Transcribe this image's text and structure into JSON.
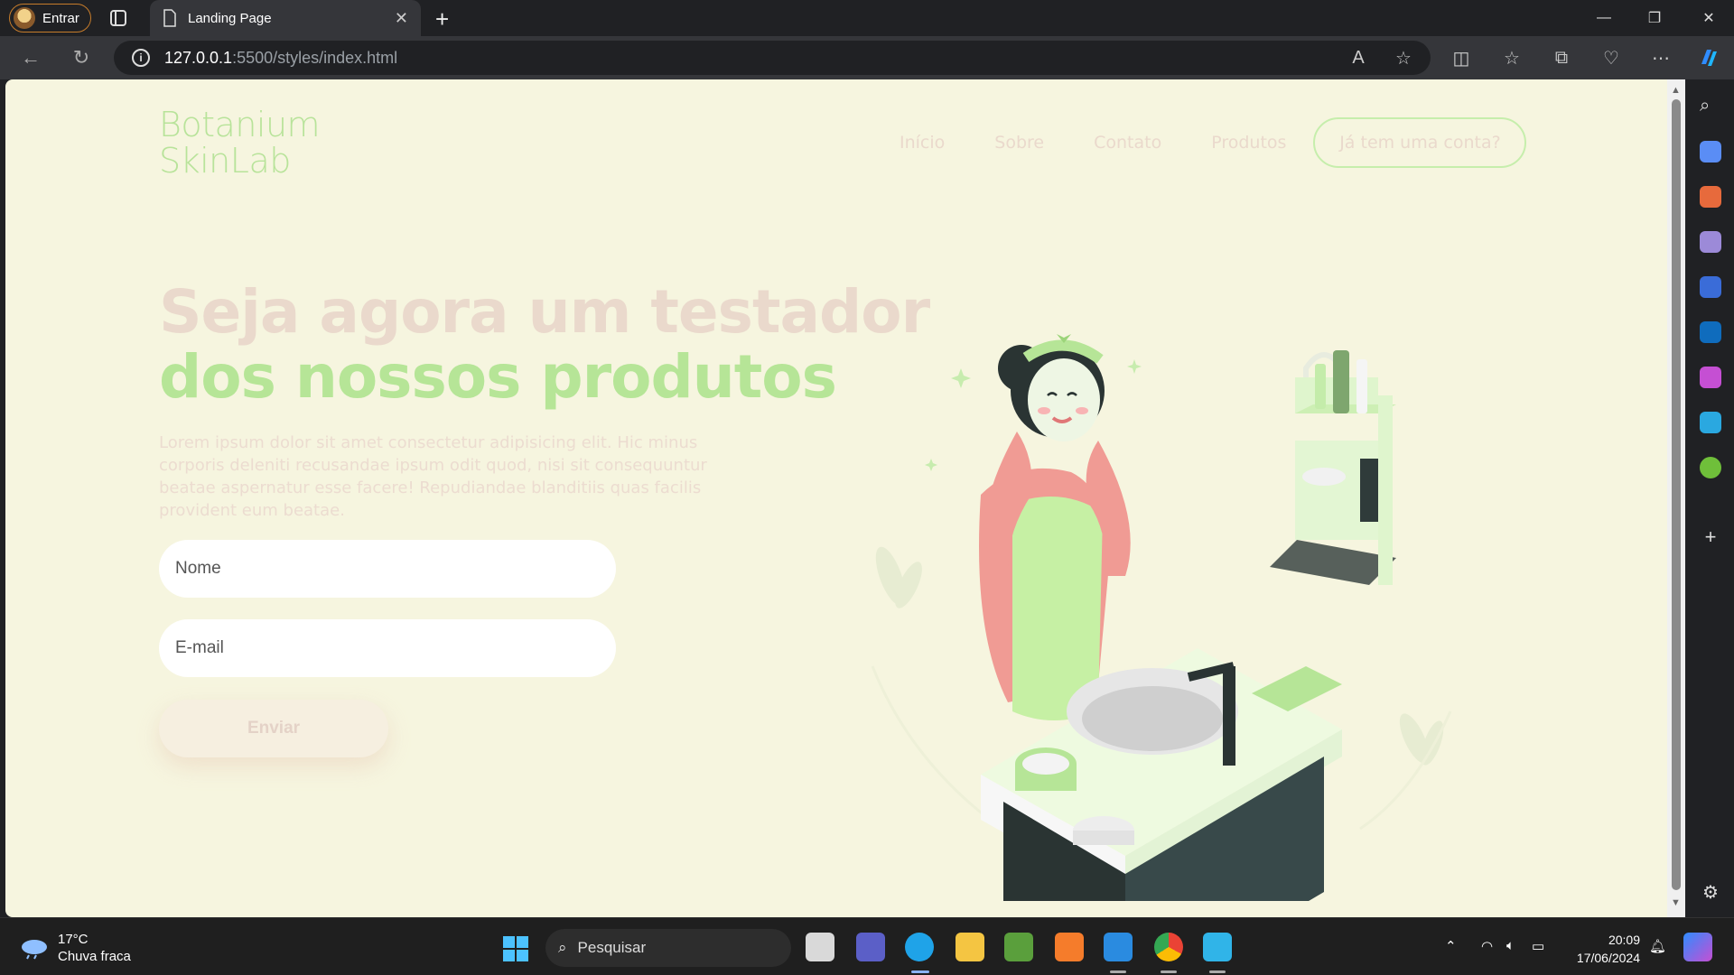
{
  "browser": {
    "profile_label": "Entrar",
    "tab_title": "Landing Page",
    "url_host": "127.0.0.1",
    "url_path": ":5500/styles/index.html"
  },
  "page": {
    "logo_line1": "Botanium",
    "logo_line2": "SkinLab",
    "nav": [
      "Início",
      "Sobre",
      "Contato",
      "Produtos"
    ],
    "cta": "Já tem uma conta?",
    "headline_line1": "Seja agora um testador",
    "headline_line2": "dos nossos produtos",
    "lead": "Lorem ipsum dolor sit amet consectetur adipisicing elit. Hic minus corporis deleniti recusandae ipsum odit quod, nisi sit consequuntur beatae aspernatur esse facere! Repudiandae blanditiis quas facilis provident eum beatae.",
    "name_placeholder": "Nome",
    "email_placeholder": "E-mail",
    "submit": "Enviar",
    "colors": {
      "background": "#f6f5df",
      "green": "#b6e597",
      "beige": "#ead9cc"
    }
  },
  "taskbar": {
    "temperature": "17°C",
    "weather": "Chuva fraca",
    "search_label": "Pesquisar",
    "time": "20:09",
    "date": "17/06/2024"
  }
}
